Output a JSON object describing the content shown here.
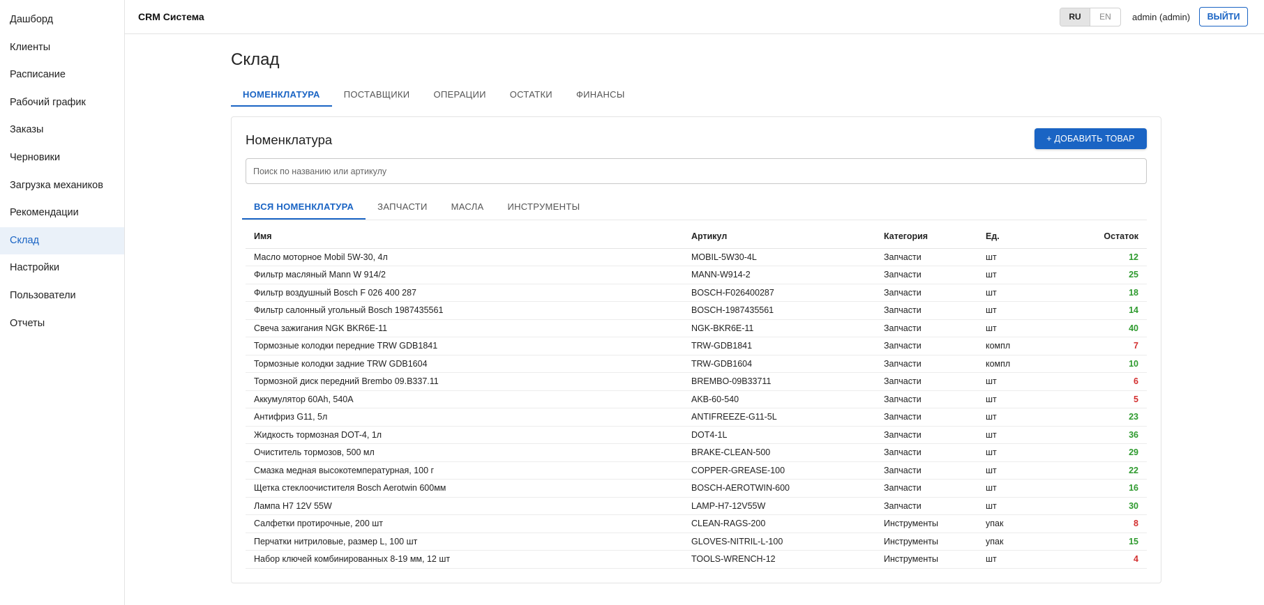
{
  "sidebar": {
    "items": [
      {
        "label": "Дашборд",
        "active": false
      },
      {
        "label": "Клиенты",
        "active": false
      },
      {
        "label": "Расписание",
        "active": false
      },
      {
        "label": "Рабочий график",
        "active": false
      },
      {
        "label": "Заказы",
        "active": false
      },
      {
        "label": "Черновики",
        "active": false
      },
      {
        "label": "Загрузка механиков",
        "active": false
      },
      {
        "label": "Рекомендации",
        "active": false
      },
      {
        "label": "Склад",
        "active": true
      },
      {
        "label": "Настройки",
        "active": false
      },
      {
        "label": "Пользователи",
        "active": false
      },
      {
        "label": "Отчеты",
        "active": false
      }
    ]
  },
  "header": {
    "app_title": "CRM Система",
    "lang_ru": "RU",
    "lang_en": "EN",
    "user": "admin (admin)",
    "logout_label": "ВЫЙТИ"
  },
  "page": {
    "title": "Склад",
    "tabs": [
      "НОМЕНКЛАТУРА",
      "ПОСТАВЩИКИ",
      "ОПЕРАЦИИ",
      "ОСТАТКИ",
      "ФИНАНСЫ"
    ],
    "active_tab": 0
  },
  "card": {
    "title": "Номенклатура",
    "add_label": "+ ДОБАВИТЬ ТОВАР",
    "search_placeholder": "Поиск по названию или артикулу",
    "search_value": "",
    "tabs": [
      "ВСЯ НОМЕНКЛАТУРА",
      "ЗАПЧАСТИ",
      "МАСЛА",
      "ИНСТРУМЕНТЫ"
    ],
    "active_tab": 0
  },
  "table": {
    "columns": {
      "name": "Имя",
      "sku": "Артикул",
      "category": "Категория",
      "unit": "Ед.",
      "stock": "Остаток"
    },
    "rows": [
      {
        "name": "Масло моторное Mobil 5W-30, 4л",
        "sku": "MOBIL-5W30-4L",
        "category": "Запчасти",
        "unit": "шт",
        "stock": "12",
        "status": "ok"
      },
      {
        "name": "Фильтр масляный Mann W 914/2",
        "sku": "MANN-W914-2",
        "category": "Запчасти",
        "unit": "шт",
        "stock": "25",
        "status": "ok"
      },
      {
        "name": "Фильтр воздушный Bosch F 026 400 287",
        "sku": "BOSCH-F026400287",
        "category": "Запчасти",
        "unit": "шт",
        "stock": "18",
        "status": "ok"
      },
      {
        "name": "Фильтр салонный угольный Bosch 1987435561",
        "sku": "BOSCH-1987435561",
        "category": "Запчасти",
        "unit": "шт",
        "stock": "14",
        "status": "ok"
      },
      {
        "name": "Свеча зажигания NGK BKR6E-11",
        "sku": "NGK-BKR6E-11",
        "category": "Запчасти",
        "unit": "шт",
        "stock": "40",
        "status": "ok"
      },
      {
        "name": "Тормозные колодки передние TRW GDB1841",
        "sku": "TRW-GDB1841",
        "category": "Запчасти",
        "unit": "компл",
        "stock": "7",
        "status": "low"
      },
      {
        "name": "Тормозные колодки задние TRW GDB1604",
        "sku": "TRW-GDB1604",
        "category": "Запчасти",
        "unit": "компл",
        "stock": "10",
        "status": "ok"
      },
      {
        "name": "Тормозной диск передний Brembo 09.B337.11",
        "sku": "BREMBO-09B33711",
        "category": "Запчасти",
        "unit": "шт",
        "stock": "6",
        "status": "low"
      },
      {
        "name": "Аккумулятор 60Ah, 540A",
        "sku": "AKB-60-540",
        "category": "Запчасти",
        "unit": "шт",
        "stock": "5",
        "status": "low"
      },
      {
        "name": "Антифриз G11, 5л",
        "sku": "ANTIFREEZE-G11-5L",
        "category": "Запчасти",
        "unit": "шт",
        "stock": "23",
        "status": "ok"
      },
      {
        "name": "Жидкость тормозная DOT-4, 1л",
        "sku": "DOT4-1L",
        "category": "Запчасти",
        "unit": "шт",
        "stock": "36",
        "status": "ok"
      },
      {
        "name": "Очиститель тормозов, 500 мл",
        "sku": "BRAKE-CLEAN-500",
        "category": "Запчасти",
        "unit": "шт",
        "stock": "29",
        "status": "ok"
      },
      {
        "name": "Смазка медная высокотемпературная, 100 г",
        "sku": "COPPER-GREASE-100",
        "category": "Запчасти",
        "unit": "шт",
        "stock": "22",
        "status": "ok"
      },
      {
        "name": "Щетка стеклоочистителя Bosch Aerotwin 600мм",
        "sku": "BOSCH-AEROTWIN-600",
        "category": "Запчасти",
        "unit": "шт",
        "stock": "16",
        "status": "ok"
      },
      {
        "name": "Лампа H7 12V 55W",
        "sku": "LAMP-H7-12V55W",
        "category": "Запчасти",
        "unit": "шт",
        "stock": "30",
        "status": "ok"
      },
      {
        "name": "Салфетки протирочные, 200 шт",
        "sku": "CLEAN-RAGS-200",
        "category": "Инструменты",
        "unit": "упак",
        "stock": "8",
        "status": "low"
      },
      {
        "name": "Перчатки нитриловые, размер L, 100 шт",
        "sku": "GLOVES-NITRIL-L-100",
        "category": "Инструменты",
        "unit": "упак",
        "stock": "15",
        "status": "ok"
      },
      {
        "name": "Набор ключей комбинированных 8-19 мм, 12 шт",
        "sku": "TOOLS-WRENCH-12",
        "category": "Инструменты",
        "unit": "шт",
        "stock": "4",
        "status": "low"
      }
    ]
  },
  "colors": {
    "accent": "#1a64c4",
    "stock_ok": "#2e9a2e",
    "stock_low": "#d32f2f",
    "sidebar_active_bg": "#eaf1f9"
  }
}
